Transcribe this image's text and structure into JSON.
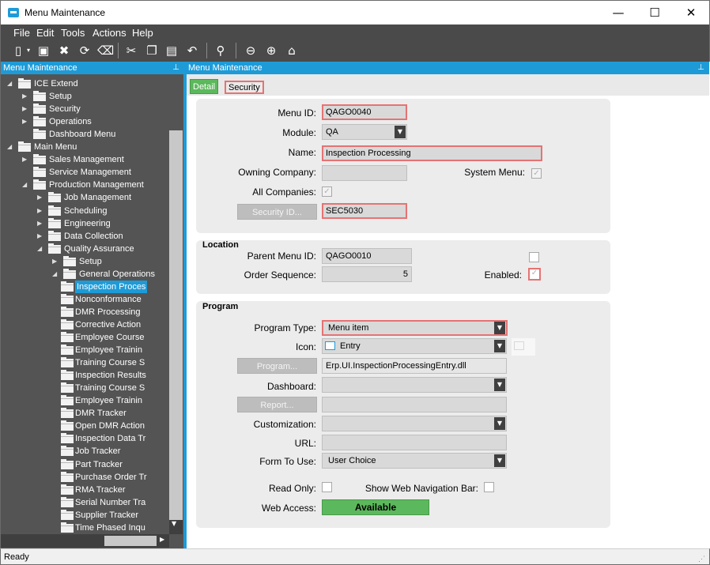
{
  "window": {
    "title": "Menu Maintenance",
    "minimize": "—",
    "maximize": "☐",
    "close": "✕"
  },
  "menubar": [
    "File",
    "Edit",
    "Tools",
    "Actions",
    "Help"
  ],
  "toolbar_icons": [
    "new-icon",
    "save-icon",
    "delete-icon",
    "refresh-icon",
    "clear-icon",
    "cut-icon",
    "copy-icon",
    "paste-icon",
    "undo-icon",
    "search-icon",
    "back-icon",
    "forward-icon",
    "home-icon"
  ],
  "left_panel": {
    "title": "Menu Maintenance",
    "tree": [
      {
        "label": "ICE Extend",
        "expanded": true
      },
      {
        "label": "Setup"
      },
      {
        "label": "Security"
      },
      {
        "label": "Operations"
      },
      {
        "label": "Dashboard Menu"
      },
      {
        "label": "Main Menu",
        "expanded": true
      },
      {
        "label": "Sales Management"
      },
      {
        "label": "Service Management"
      },
      {
        "label": "Production Management",
        "expanded": true
      },
      {
        "label": "Job Management"
      },
      {
        "label": "Scheduling"
      },
      {
        "label": "Engineering"
      },
      {
        "label": "Data Collection"
      },
      {
        "label": "Quality Assurance",
        "expanded": true
      },
      {
        "label": "Setup"
      },
      {
        "label": "General Operations",
        "expanded": true
      },
      {
        "label": "Inspection Proces",
        "selected": true
      },
      {
        "label": "Nonconformance"
      },
      {
        "label": "DMR Processing"
      },
      {
        "label": "Corrective Action"
      },
      {
        "label": "Employee Course"
      },
      {
        "label": "Employee Trainin"
      },
      {
        "label": "Training Course S"
      },
      {
        "label": "Inspection Results"
      },
      {
        "label": "Training Course S"
      },
      {
        "label": "Employee Trainin"
      },
      {
        "label": "DMR Tracker"
      },
      {
        "label": "Open DMR Action"
      },
      {
        "label": "Inspection Data Tr"
      },
      {
        "label": "Job Tracker"
      },
      {
        "label": "Part Tracker"
      },
      {
        "label": "Purchase Order Tr"
      },
      {
        "label": "RMA Tracker"
      },
      {
        "label": "Serial Number Tra"
      },
      {
        "label": "Supplier Tracker"
      },
      {
        "label": "Time Phased Inqu"
      }
    ]
  },
  "right_panel": {
    "title": "Menu Maintenance",
    "tabs": [
      {
        "label": "Detail",
        "active": true
      },
      {
        "label": "Security",
        "active": false
      }
    ],
    "general": {
      "menu_id_label": "Menu ID:",
      "menu_id": "QAGO0040",
      "module_label": "Module:",
      "module": "QA",
      "name_label": "Name:",
      "name": "Inspection Processing",
      "owning_company_label": "Owning Company:",
      "owning_company": "",
      "system_menu_label": "System Menu:",
      "system_menu": true,
      "all_companies_label": "All Companies:",
      "all_companies": true,
      "security_id_button": "Security ID...",
      "security_id": "SEC5030"
    },
    "location": {
      "title": "Location",
      "parent_menu_id_label": "Parent Menu ID:",
      "parent_menu_id": "QAGO0010",
      "order_sequence_label": "Order Sequence:",
      "order_sequence": "5",
      "enabled_label": "Enabled:",
      "enabled": true,
      "extra_checkbox": false
    },
    "program": {
      "title": "Program",
      "program_type_label": "Program Type:",
      "program_type": "Menu item",
      "icon_label": "Icon:",
      "icon": "Entry",
      "program_button": "Program...",
      "program": "Erp.UI.InspectionProcessingEntry.dll",
      "dashboard_label": "Dashboard:",
      "dashboard": "",
      "report_button": "Report...",
      "report": "",
      "customization_label": "Customization:",
      "customization": "",
      "url_label": "URL:",
      "url": "",
      "form_to_use_label": "Form To Use:",
      "form_to_use": "User Choice",
      "read_only_label": "Read Only:",
      "read_only": false,
      "show_web_nav_label": "Show Web Navigation Bar:",
      "show_web_nav": false,
      "web_access_label": "Web Access:",
      "web_access": "Available"
    }
  },
  "status": "Ready",
  "colors": {
    "accent": "#1e9bd7",
    "dark": "#4a4a4a",
    "highlight_border": "#e57373",
    "available": "#5cb85c"
  }
}
